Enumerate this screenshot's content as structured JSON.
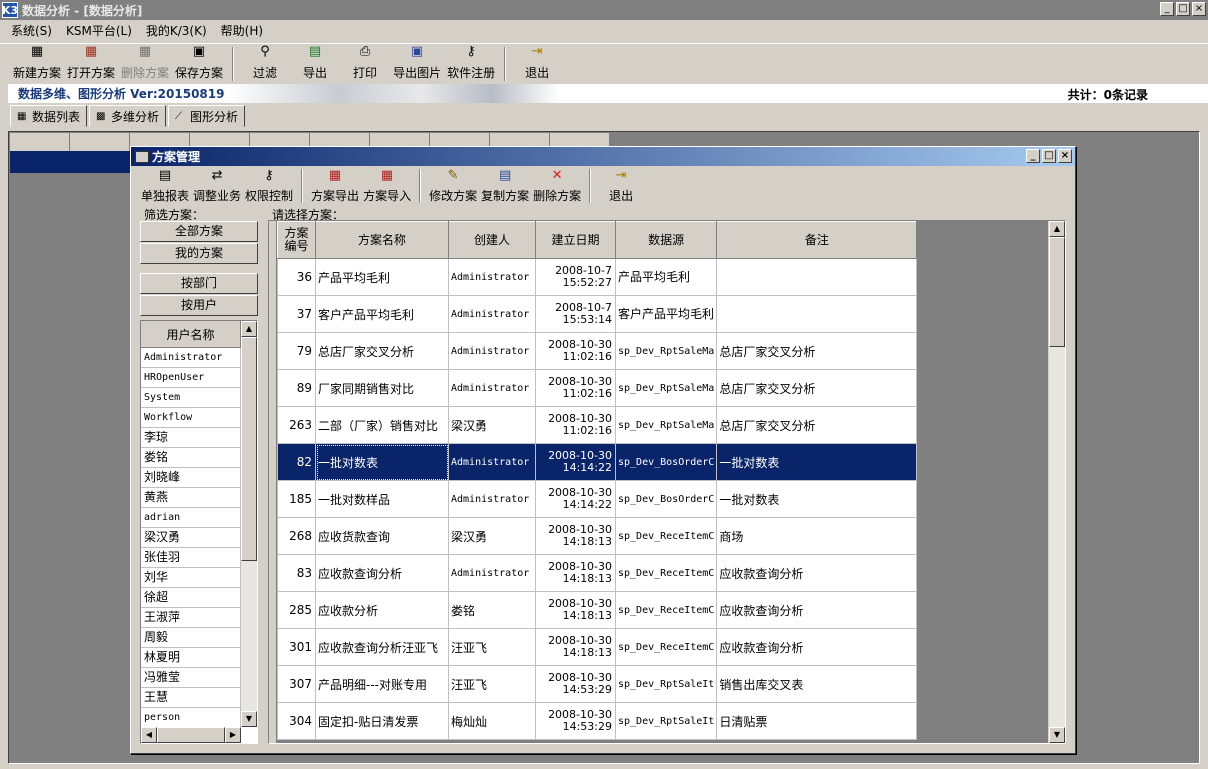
{
  "window": {
    "title": "数据分析 - [数据分析]",
    "icon": "K3",
    "controls": [
      "_",
      "□",
      "×"
    ]
  },
  "menu": [
    "系统(S)",
    "KSM平台(L)",
    "我的K/3(K)",
    "帮助(H)"
  ],
  "toolbar": {
    "new_plan": "新建方案",
    "open_plan": "打开方案",
    "delete_plan": "删除方案",
    "save_plan": "保存方案",
    "filter": "过滤",
    "export": "导出",
    "print": "打印",
    "export_image": "导出图片",
    "register": "软件注册",
    "exit": "退出"
  },
  "banner": {
    "title": "数据多维、图形分析 Ver:20150819",
    "count": "共计：0条记录"
  },
  "tabs": [
    "数据列表",
    "多维分析",
    "图形分析"
  ],
  "dialog": {
    "title": "方案管理",
    "toolbar": {
      "single_report": "单独报表",
      "adjust_business": "调整业务",
      "permission": "权限控制",
      "plan_export": "方案导出",
      "plan_import": "方案导入",
      "modify_plan": "修改方案",
      "copy_plan": "复制方案",
      "delete_plan": "删除方案",
      "exit": "退出"
    },
    "filter": {
      "group_label": "筛选方案：",
      "all_plans": "全部方案",
      "my_plans": "我的方案",
      "by_dept": "按部门",
      "by_user": "按用户",
      "user_header": "用户名称",
      "users": [
        "Administrator",
        "HROpenUser",
        "System",
        "Workflow",
        "李琼",
        "娄铭",
        "刘晓峰",
        "黄燕",
        "adrian",
        "梁汉勇",
        "张佳羽",
        "刘华",
        "徐超",
        "王淑萍",
        "周毅",
        "林夏明",
        "冯雅莹",
        "王慧",
        "person"
      ]
    },
    "plans": {
      "group_label": "请选择方案：",
      "columns": [
        "方案编号",
        "方案名称",
        "创建人",
        "建立日期",
        "数据源",
        "备注"
      ],
      "rows": [
        {
          "id": "36",
          "name": "产品平均毛利",
          "creator": "Administrator",
          "date": "2008-10-7",
          "time": "15:52:27",
          "source": "产品平均毛利",
          "note": ""
        },
        {
          "id": "37",
          "name": "客户产品平均毛利",
          "creator": "Administrator",
          "date": "2008-10-7",
          "time": "15:53:14",
          "source": "客户产品平均毛利",
          "note": ""
        },
        {
          "id": "79",
          "name": "总店厂家交叉分析",
          "creator": "Administrator",
          "date": "2008-10-30",
          "time": "11:02:16",
          "source": "sp_Dev_RptSaleMa",
          "note": "总店厂家交叉分析"
        },
        {
          "id": "89",
          "name": "厂家同期销售对比",
          "creator": "Administrator",
          "date": "2008-10-30",
          "time": "11:02:16",
          "source": "sp_Dev_RptSaleMa",
          "note": "总店厂家交叉分析"
        },
        {
          "id": "263",
          "name": "二部（厂家）销售对比",
          "creator": "梁汉勇",
          "date": "2008-10-30",
          "time": "11:02:16",
          "source": "sp_Dev_RptSaleMa",
          "note": "总店厂家交叉分析"
        },
        {
          "id": "82",
          "name": "一批对数表",
          "creator": "Administrator",
          "date": "2008-10-30",
          "time": "14:14:22",
          "source": "sp_Dev_BosOrderC",
          "note": "一批对数表"
        },
        {
          "id": "185",
          "name": "一批对数样品",
          "creator": "Administrator",
          "date": "2008-10-30",
          "time": "14:14:22",
          "source": "sp_Dev_BosOrderC",
          "note": "一批对数表"
        },
        {
          "id": "268",
          "name": "应收货款查询",
          "creator": "梁汉勇",
          "date": "2008-10-30",
          "time": "14:18:13",
          "source": "sp_Dev_ReceItemC",
          "note": "商场"
        },
        {
          "id": "83",
          "name": "应收款查询分析",
          "creator": "Administrator",
          "date": "2008-10-30",
          "time": "14:18:13",
          "source": "sp_Dev_ReceItemC",
          "note": "应收款查询分析"
        },
        {
          "id": "285",
          "name": "应收款分析",
          "creator": "娄铭",
          "date": "2008-10-30",
          "time": "14:18:13",
          "source": "sp_Dev_ReceItemC",
          "note": "应收款查询分析"
        },
        {
          "id": "301",
          "name": "应收款查询分析汪亚飞",
          "creator": "汪亚飞",
          "date": "2008-10-30",
          "time": "14:18:13",
          "source": "sp_Dev_ReceItemC",
          "note": "应收款查询分析"
        },
        {
          "id": "307",
          "name": "产品明细---对账专用",
          "creator": "汪亚飞",
          "date": "2008-10-30",
          "time": "14:53:29",
          "source": "sp_Dev_RptSaleIt",
          "note": "销售出库交叉表"
        },
        {
          "id": "304",
          "name": "固定扣-贴日清发票",
          "creator": "梅灿灿",
          "date": "2008-10-30",
          "time": "14:53:29",
          "source": "sp_Dev_RptSaleIt",
          "note": "日清贴票"
        }
      ],
      "selected_row": 5
    }
  }
}
